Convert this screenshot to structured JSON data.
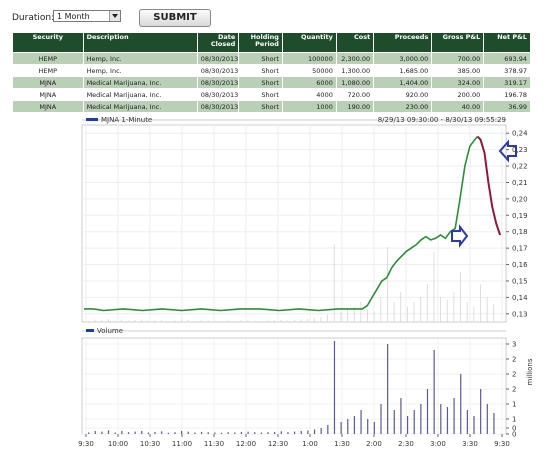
{
  "toolbar": {
    "duration_label": "Duration:",
    "duration_value": "1 Month",
    "submit_label": "SUBMIT"
  },
  "table": {
    "headers": [
      "Security",
      "Description",
      "Date Closed",
      "Holding Period",
      "Quantity",
      "Cost",
      "Proceeds",
      "Gross P&L",
      "Net P&L"
    ],
    "rows": [
      [
        "HEMP",
        "Hemp, Inc.",
        "08/30/2013",
        "Short",
        "100000",
        "2,300.00",
        "3,000.00",
        "700.00",
        "693.94"
      ],
      [
        "HEMP",
        "Hemp, Inc.",
        "08/30/2013",
        "Short",
        "50000",
        "1,300.00",
        "1,685.00",
        "385.00",
        "378.97"
      ],
      [
        "MJNA",
        "Medical Marijuana, Inc.",
        "08/30/2013",
        "Short",
        "6000",
        "1,080.00",
        "1,404.00",
        "324.00",
        "319.17"
      ],
      [
        "MJNA",
        "Medical Marijuana, Inc.",
        "08/30/2013",
        "Short",
        "4000",
        "720.00",
        "920.00",
        "200.00",
        "196.78"
      ],
      [
        "MJNA",
        "Medical Marijuana, Inc.",
        "08/30/2013",
        "Short",
        "1000",
        "190.00",
        "230.00",
        "40.00",
        "36.99"
      ]
    ]
  },
  "chart_data": {
    "type": "line",
    "title": "MJNA 1-Minute",
    "range_text": "8/29/13 09:30:00 - 8/30/13 09:55:29",
    "colors": {
      "price": "#2e8b3a",
      "down": "#8b1a3a",
      "volume": "#5a5a9a",
      "arrow": "#2b3aa8"
    },
    "price_axis": {
      "ticks": [
        "0,24",
        "0,23",
        "0,22",
        "0,21",
        "0,20",
        "0,19",
        "0,18",
        "0,17",
        "0,16",
        "0,15",
        "0,14",
        "0,13"
      ],
      "ylim": [
        0.125,
        0.245
      ]
    },
    "volume_axis": {
      "label": "millions",
      "ticks": [
        "3",
        "2",
        "2",
        "2",
        "1",
        "1",
        "0",
        "0"
      ],
      "ylim": [
        0,
        3.2
      ]
    },
    "volume_legend": "Volume",
    "x_ticks": [
      "9:30",
      "10:00",
      "10:30",
      "11:00",
      "11:30",
      "12:00",
      "12:30",
      "1:00",
      "1:30",
      "2:00",
      "2:30",
      "3:00",
      "3:30",
      "9:30"
    ],
    "price_series": [
      [
        0,
        0.133
      ],
      [
        10,
        0.133
      ],
      [
        20,
        0.132
      ],
      [
        40,
        0.133
      ],
      [
        60,
        0.132
      ],
      [
        80,
        0.133
      ],
      [
        100,
        0.132
      ],
      [
        120,
        0.133
      ],
      [
        140,
        0.132
      ],
      [
        160,
        0.133
      ],
      [
        180,
        0.133
      ],
      [
        200,
        0.132
      ],
      [
        220,
        0.133
      ],
      [
        240,
        0.132
      ],
      [
        260,
        0.133
      ],
      [
        275,
        0.133
      ],
      [
        285,
        0.133
      ],
      [
        290,
        0.135
      ],
      [
        295,
        0.14
      ],
      [
        300,
        0.145
      ],
      [
        305,
        0.15
      ],
      [
        310,
        0.152
      ],
      [
        315,
        0.158
      ],
      [
        320,
        0.162
      ],
      [
        325,
        0.165
      ],
      [
        330,
        0.168
      ],
      [
        335,
        0.17
      ],
      [
        340,
        0.172
      ],
      [
        345,
        0.175
      ],
      [
        350,
        0.177
      ],
      [
        355,
        0.175
      ],
      [
        360,
        0.176
      ],
      [
        365,
        0.178
      ],
      [
        370,
        0.176
      ],
      [
        375,
        0.18
      ],
      [
        380,
        0.182
      ],
      [
        385,
        0.2
      ],
      [
        390,
        0.22
      ],
      [
        395,
        0.232
      ],
      [
        400,
        0.236
      ],
      [
        403,
        0.238
      ],
      [
        406,
        0.236
      ],
      [
        410,
        0.228
      ],
      [
        414,
        0.21
      ],
      [
        418,
        0.195
      ],
      [
        422,
        0.185
      ],
      [
        426,
        0.178
      ]
    ],
    "volume_series": [
      0.05,
      0.1,
      0.08,
      0.12,
      0.05,
      0.1,
      0.06,
      0.08,
      0.1,
      0.05,
      0.07,
      0.09,
      0.04,
      0.06,
      0.1,
      0.08,
      0.05,
      0.07,
      0.06,
      0.05,
      0.04,
      0.06,
      0.05,
      0.07,
      0.08,
      0.06,
      0.05,
      0.06,
      0.07,
      0.09,
      0.06,
      0.08,
      0.1,
      0.12,
      0.15,
      0.2,
      0.3,
      3.1,
      0.4,
      0.5,
      0.6,
      0.8,
      0.5,
      0.4,
      1.0,
      3.0,
      0.8,
      1.2,
      0.6,
      0.8,
      1.0,
      1.5,
      2.8,
      1.0,
      0.9,
      1.2,
      2.0,
      0.8,
      0.6,
      1.5,
      1.0,
      0.7
    ]
  }
}
